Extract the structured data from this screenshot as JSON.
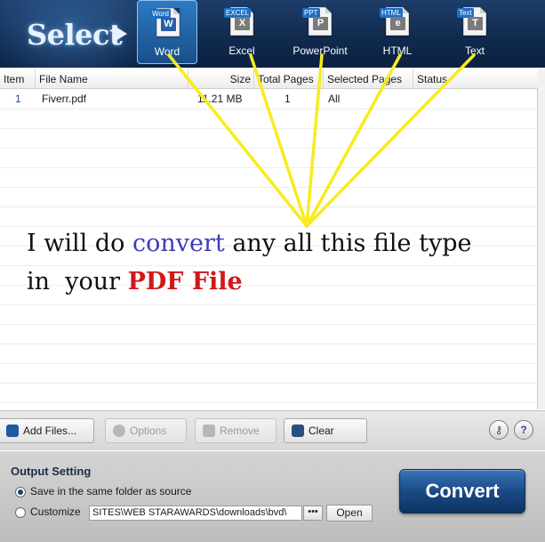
{
  "header": {
    "title": "Select"
  },
  "formats": [
    {
      "tag": "Word",
      "glyph": "W",
      "label": "Word",
      "active": true
    },
    {
      "tag": "EXCEL",
      "glyph": "X",
      "label": "Excel"
    },
    {
      "tag": "PPT",
      "glyph": "P",
      "label": "PowerPoint"
    },
    {
      "tag": "HTML",
      "glyph": "e",
      "label": "HTML"
    },
    {
      "tag": "Text",
      "glyph": "T",
      "label": "Text"
    }
  ],
  "grid": {
    "columns": [
      "Item",
      "File Name",
      "Size",
      "Total Pages",
      "Selected Pages",
      "Status"
    ],
    "rows": [
      {
        "item": "1",
        "name": "Fiverr.pdf",
        "size": "11.21  MB",
        "pages": "1",
        "selected": "All",
        "status": ""
      }
    ]
  },
  "promo": {
    "part1": "I will do ",
    "part2": "convert",
    "part3": " any all this file type",
    "part4": "in  your ",
    "part5": "PDF File"
  },
  "toolbar": {
    "add_files": "Add Files...",
    "options": "Options",
    "remove": "Remove",
    "clear": "Clear",
    "help_glyph": "?"
  },
  "output": {
    "title": "Output Setting",
    "option_same": "Save in the same folder as source",
    "option_custom": "Customize",
    "path": "SITES\\WEB STARAWARDS\\downloads\\bvd\\",
    "browse": "•••",
    "open": "Open",
    "convert": "Convert"
  },
  "colors": {
    "accent": "#1a4a85",
    "highlight_lines": "#f7ec1e",
    "promo_blue": "#3a3db6",
    "promo_red": "#d0181b"
  }
}
